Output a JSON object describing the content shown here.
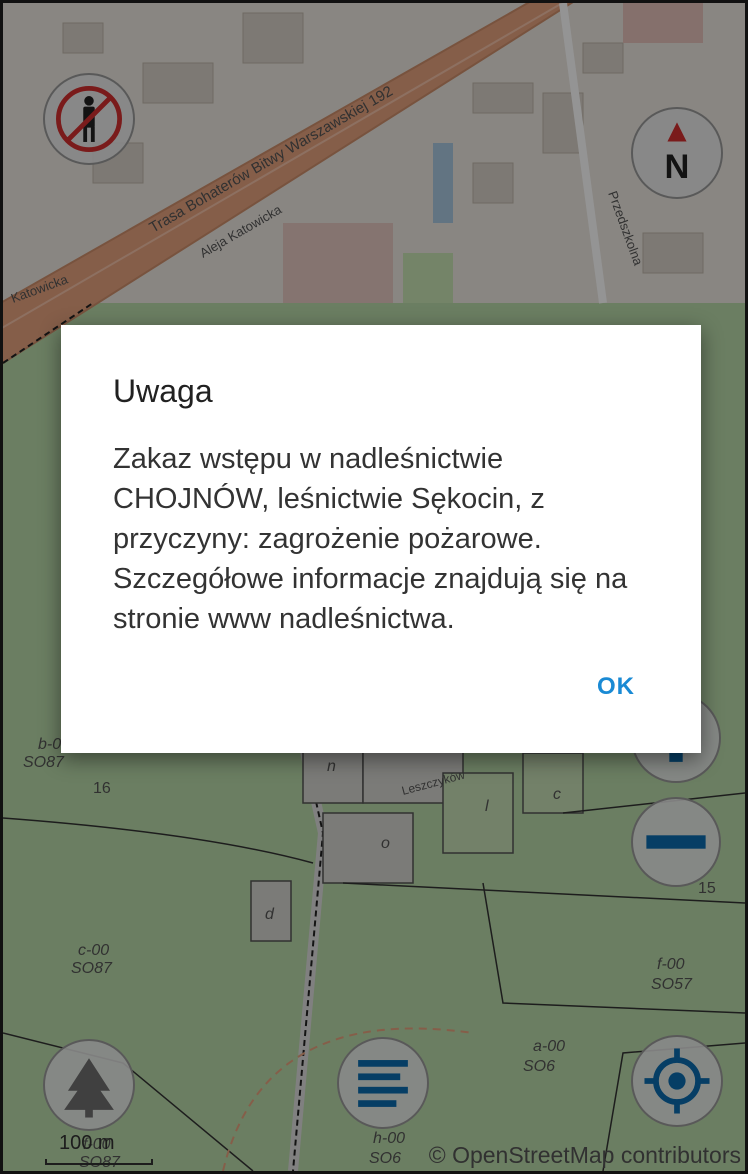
{
  "map": {
    "streets": [
      "Trasa Bohaterów Bitwy Warszawskiej 192",
      "Aleja Katowicka",
      "Katowicka",
      "Przedszkolna",
      "Leszczyków"
    ],
    "parcels": [
      "b-0",
      "SO87",
      "c-00",
      "SO87",
      "f-00",
      "SO57",
      "a-00",
      "SO6",
      "f-00",
      "SO87",
      "h-00",
      "SO6"
    ],
    "area_numbers": [
      "16",
      "15"
    ],
    "parcel_letters": [
      "n",
      "l",
      "c",
      "o",
      "d"
    ],
    "attribution": "© OpenStreetMap contributors",
    "scale_label": "100 m"
  },
  "dialog": {
    "title": "Uwaga",
    "message": "Zakaz wstępu w nadleśnictwie CHOJNÓW, leśnictwie Sękocin, z przyczyny: zagrożenie pożarowe. Szczegółowe informacje znajdują się na stronie www nadleśnictwa.",
    "ok_label": "OK"
  },
  "colors": {
    "accent": "#1a8ad4",
    "forest": "#b6d7a8",
    "road": "#e3a07a"
  },
  "controls": [
    "no-entry-icon",
    "compass-icon",
    "zoom-in-icon",
    "zoom-out-icon",
    "forest-layer-icon",
    "menu-icon",
    "locate-icon"
  ]
}
